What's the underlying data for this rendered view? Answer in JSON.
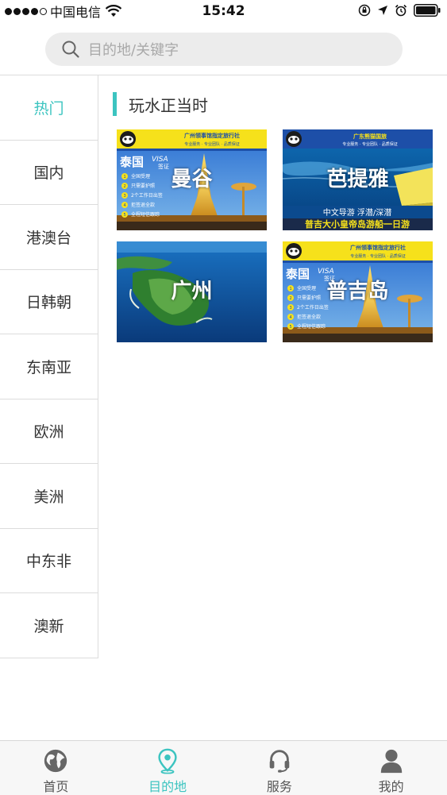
{
  "status_bar": {
    "carrier": "中国电信",
    "time": "15:42"
  },
  "search": {
    "placeholder": "目的地/关键字"
  },
  "sidebar": {
    "items": [
      {
        "label": "热门",
        "active": true
      },
      {
        "label": "国内"
      },
      {
        "label": "港澳台"
      },
      {
        "label": "日韩朝"
      },
      {
        "label": "东南亚"
      },
      {
        "label": "欧洲"
      },
      {
        "label": "美洲"
      },
      {
        "label": "中东非"
      },
      {
        "label": "澳新"
      }
    ]
  },
  "main": {
    "section_title": "玩水正当时",
    "cards": [
      {
        "title": "曼谷",
        "banner_top": "广州领事馆指定旅行社",
        "banner_sub": "专业服务 · 专业团队 · 品质保证",
        "country": "泰国",
        "visa": "VISA",
        "visa_sub": "签证",
        "list": [
          "全国受理",
          "只需要护照",
          "2个工作日出签",
          "拒签退全款",
          "全程短信跟踪"
        ]
      },
      {
        "title": "芭提雅",
        "banner_top": "广东熊猫国旅",
        "banner_sub": "专业服务 · 专业团队 · 品质保证",
        "caption1": "中文导游 浮潜/深潜",
        "caption2": "普吉大小皇帝岛游船一日游"
      },
      {
        "title": "广州"
      },
      {
        "title": "普吉岛",
        "banner_top": "广州领事馆指定旅行社",
        "banner_sub": "专业服务 · 专业团队 · 品质保证",
        "country": "泰国",
        "visa": "VISA",
        "visa_sub": "签证",
        "list": [
          "全国受理",
          "只需要护照",
          "2个工作日出签",
          "拒签退全款",
          "全程短信跟踪"
        ]
      }
    ]
  },
  "tab_bar": {
    "tabs": [
      {
        "label": "首页",
        "icon": "globe-icon"
      },
      {
        "label": "目的地",
        "icon": "location-pin-icon",
        "active": true
      },
      {
        "label": "服务",
        "icon": "headset-icon"
      },
      {
        "label": "我的",
        "icon": "user-icon"
      }
    ]
  },
  "colors": {
    "accent": "#3cc4c0",
    "banner_yellow": "#f6e11b",
    "banner_blue": "#1d4fa8"
  }
}
